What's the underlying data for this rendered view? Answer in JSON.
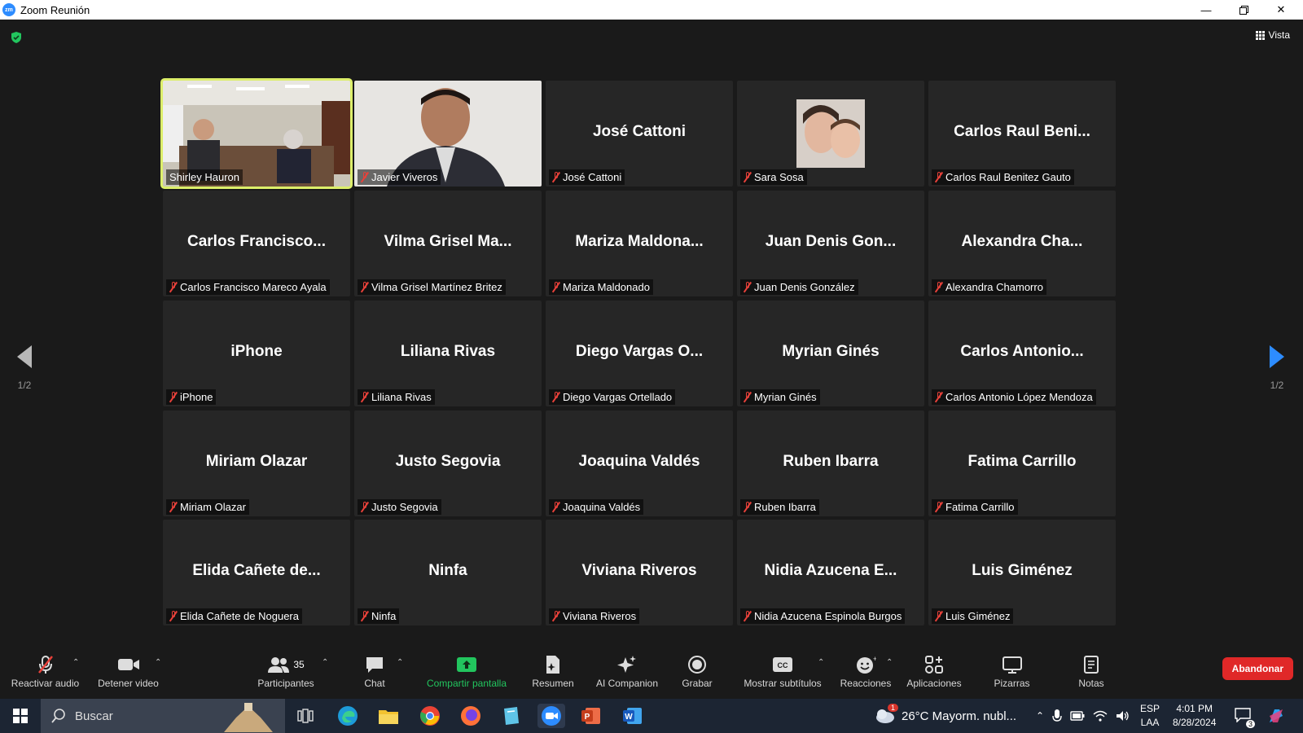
{
  "window": {
    "title": "Zoom Reunión",
    "app_icon_text": "zm"
  },
  "view_label": "Vista",
  "pagination": {
    "left": "1/2",
    "right": "1/2"
  },
  "tiles": [
    {
      "big": "",
      "name": "Shirley Hauron"
    },
    {
      "big": "",
      "name": "Javier Viveros"
    },
    {
      "big": "José Cattoni",
      "name": "José Cattoni"
    },
    {
      "big": "",
      "name": "Sara Sosa"
    },
    {
      "big": "Carlos Raul Beni...",
      "name": "Carlos Raul Benitez Gauto"
    },
    {
      "big": "Carlos Francisco...",
      "name": "Carlos Francisco Mareco Ayala"
    },
    {
      "big": "Vilma Grisel Ma...",
      "name": "Vilma Grisel Martínez Britez"
    },
    {
      "big": "Mariza Maldona...",
      "name": "Mariza Maldonado"
    },
    {
      "big": "Juan Denis Gon...",
      "name": "Juan Denis González"
    },
    {
      "big": "Alexandra Cha...",
      "name": "Alexandra Chamorro"
    },
    {
      "big": "iPhone",
      "name": "iPhone"
    },
    {
      "big": "Liliana Rivas",
      "name": "Liliana Rivas"
    },
    {
      "big": "Diego Vargas O...",
      "name": "Diego Vargas Ortellado"
    },
    {
      "big": "Myrian Ginés",
      "name": "Myrian Ginés"
    },
    {
      "big": "Carlos Antonio...",
      "name": "Carlos Antonio López Mendoza"
    },
    {
      "big": "Miriam Olazar",
      "name": "Miriam Olazar"
    },
    {
      "big": "Justo Segovia",
      "name": "Justo Segovia"
    },
    {
      "big": "Joaquina Valdés",
      "name": "Joaquina Valdés"
    },
    {
      "big": "Ruben Ibarra",
      "name": "Ruben Ibarra"
    },
    {
      "big": "Fatima Carrillo",
      "name": "Fatima Carrillo"
    },
    {
      "big": "Elida Cañete de...",
      "name": "Elida Cañete de Noguera"
    },
    {
      "big": "Ninfa",
      "name": "Ninfa"
    },
    {
      "big": "Viviana Riveros",
      "name": "Viviana Riveros"
    },
    {
      "big": "Nidia Azucena E...",
      "name": "Nidia Azucena Espinola Burgos"
    },
    {
      "big": "Luis Giménez",
      "name": "Luis Giménez"
    }
  ],
  "toolbar": {
    "unmute": "Reactivar audio",
    "stop_video": "Detener video",
    "participants": "Participantes",
    "participants_count": "35",
    "chat": "Chat",
    "share": "Compartir pantalla",
    "summary": "Resumen",
    "companion": "AI Companion",
    "record": "Grabar",
    "captions": "Mostrar subtítulos",
    "reactions": "Reacciones",
    "apps": "Aplicaciones",
    "whiteboards": "Pizarras",
    "notes": "Notas",
    "leave": "Abandonar"
  },
  "taskbar": {
    "search": "Buscar",
    "weather": "26°C  Mayorm. nubl...",
    "weather_badge": "1",
    "lang_top": "ESP",
    "lang_bottom": "LAA",
    "time": "4:01 PM",
    "date": "8/28/2024",
    "notifications": "3"
  },
  "colors": {
    "accent": "#2d8cff",
    "share_green": "#22c55e",
    "leave_red": "#e02828",
    "active_speaker": "#dcee6a"
  }
}
